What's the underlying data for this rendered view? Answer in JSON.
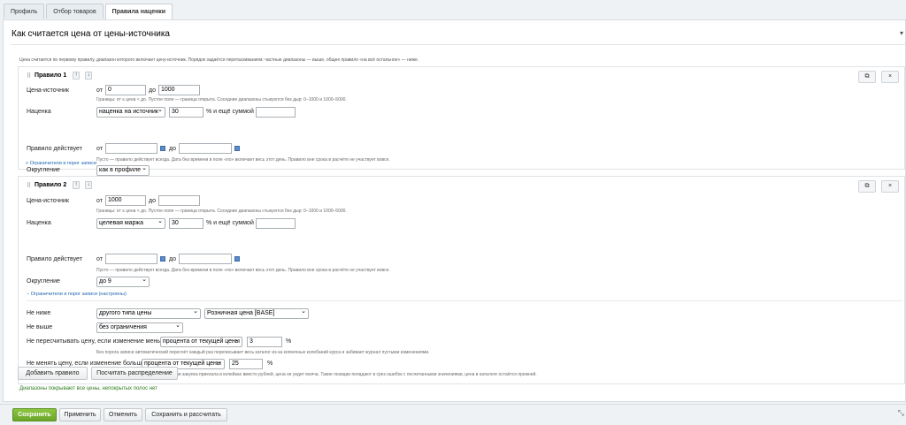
{
  "tabs": [
    {
      "label": "Профиль"
    },
    {
      "label": "Отбор товаров"
    },
    {
      "label": "Правила наценки"
    }
  ],
  "panel": {
    "title": "Как считается цена от цены-источника",
    "intro": "Цена считается по первому правилу, диапазон которого включает цену-источник. Порядок задаётся перетаскиванием: частные диапазоны — выше, общее правило «на всё остальное» — ниже."
  },
  "rule1": {
    "title": "Правило 1",
    "source_label": "Цена-источник",
    "from_label": "от",
    "from_value": "0",
    "to_label": "до",
    "to_value": "1000",
    "source_hint": "Границы: от ≤ цена < до. Пустое поле — граница открыта. Соседние диапазоны стыкуются без дыр: 0–1000 и 1000–5000.",
    "markup_label": "Наценка",
    "markup_type": "наценка на источник",
    "markup_value": "30",
    "percent_and": "% и ещё суммой",
    "markup_sum": "",
    "active_label": "Правило действует",
    "date_from_label": "от",
    "date_from": "",
    "date_to_label": "до",
    "date_to": "",
    "active_hint": "Пусто — правило действует всегда. Дата без времени в поле «по» включает весь этот день. Правило вне срока в расчёте не участвует вовсе.",
    "round_label": "Округление",
    "round_value": "как в профиле",
    "limits_link": "+ Ограничители и порог записи"
  },
  "rule2": {
    "title": "Правило 2",
    "source_label": "Цена-источник",
    "from_label": "от",
    "from_value": "1000",
    "to_label": "до",
    "to_value": "",
    "source_hint": "Границы: от ≤ цена < до. Пустое поле — граница открыта. Соседние диапазоны стыкуются без дыр: 0–1000 и 1000–5000.",
    "markup_label": "Наценка",
    "markup_type": "целевая маржа",
    "markup_value": "30",
    "percent_and": "% и ещё суммой",
    "markup_sum": "",
    "active_label": "Правило действует",
    "date_from_label": "от",
    "date_from": "",
    "date_to_label": "до",
    "date_to": "",
    "active_hint": "Пусто — правило действует всегда. Дата без времени в поле «по» включает весь этот день. Правило вне срока в расчёте не участвует вовсе.",
    "round_label": "Округление",
    "round_value": "до 9",
    "limits_link": "− Ограничители и порог записи (настроены)",
    "not_lower_label": "Не ниже",
    "not_lower_type": "другого типа цены",
    "not_lower_price": "Розничная цена [BASE]",
    "not_higher_label": "Не выше",
    "not_higher_value": "без ограничения",
    "no_recalc_label": "Не пересчитывать цену, если изменение меньше",
    "no_recalc_type": "процента от текущей цены",
    "no_recalc_value": "3",
    "no_recalc_unit": "%",
    "no_recalc_hint": "Без порога записи автоматический пересчёт каждый раз переписывает весь каталог из-за копеечных колебаний курса и забивает журнал пустыми изменениями.",
    "no_change_label": "Не менять цену, если изменение больше",
    "no_change_type": "процента от текущей цены",
    "no_change_value": "25",
    "no_change_unit": "%",
    "no_change_hint": "Предохранитель от битой выгрузки: если закупка приехала в копейках вместо рублей, цена не уедет молча. Такие позиции попадают в срез ошибок с посчитанными значениями, цена в каталоге остаётся прежней."
  },
  "actions": {
    "add_rule": "Добавить правило",
    "calc_distribution": "Посчитать распределение",
    "status": "Диапазоны покрывают все цены, непокрытых полос нет"
  },
  "footer": {
    "save": "Сохранить",
    "apply": "Применить",
    "cancel": "Отменить",
    "save_calc": "Сохранить и рассчитать"
  },
  "colors": {
    "accent_green": "#6aa52a",
    "link_blue": "#2067b0",
    "status_green": "#2e7d1f"
  }
}
